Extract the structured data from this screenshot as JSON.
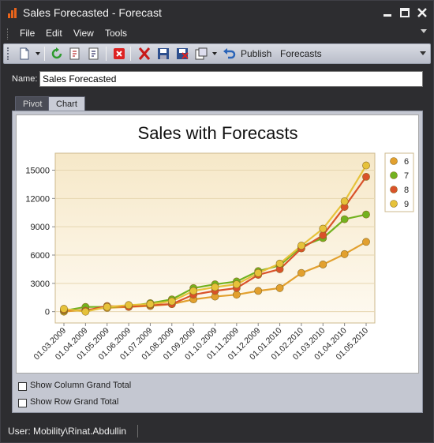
{
  "window": {
    "title": "Sales Forecasted - Forecast"
  },
  "menu": {
    "items": [
      "File",
      "Edit",
      "View",
      "Tools"
    ]
  },
  "toolbar": {
    "publish_label": "Publish",
    "forecasts_label": "Forecasts"
  },
  "form": {
    "name_label": "Name:",
    "name_value": "Sales Forecasted"
  },
  "tabs": {
    "pivot": "Pivot",
    "chart": "Chart",
    "active": "Chart"
  },
  "options": {
    "column_total": "Show Column Grand Total",
    "row_total": "Show Row Grand Total",
    "column_total_checked": false,
    "row_total_checked": false
  },
  "status": {
    "user": "User: Mobility\\Rinat.Abdullin"
  },
  "chart_data": {
    "type": "line",
    "title": "Sales with Forecasts",
    "xlabel": "",
    "ylabel": "",
    "ylim": [
      -1200,
      16800
    ],
    "yticks": [
      "0",
      "3000",
      "6000",
      "9000",
      "12000",
      "15000"
    ],
    "ytick_values": [
      0,
      3000,
      6000,
      9000,
      12000,
      15000
    ],
    "grid": true,
    "legend": "right",
    "categories": [
      "01.03.2009",
      "01.04.2009",
      "01.05.2009",
      "01.06.2009",
      "01.07.2009",
      "01.08.2009",
      "01.09.2009",
      "01.10.2009",
      "01.11.2009",
      "01.12.2009",
      "01.01.2010",
      "01.02.2010",
      "01.03.2010",
      "01.04.2010",
      "01.05.2010"
    ],
    "series": [
      {
        "name": "6",
        "color": "#e2a02e",
        "values": [
          0,
          200,
          400,
          500,
          600,
          800,
          1300,
          1600,
          1800,
          2200,
          2500,
          4100,
          5000,
          6100,
          7400
        ]
      },
      {
        "name": "7",
        "color": "#72b21f",
        "values": [
          100,
          500,
          500,
          600,
          900,
          1300,
          2500,
          2900,
          3200,
          4300,
          4900,
          6900,
          7800,
          9800,
          10300
        ]
      },
      {
        "name": "8",
        "color": "#d9522a",
        "values": [
          200,
          100,
          600,
          500,
          700,
          800,
          1800,
          2200,
          2500,
          3900,
          4500,
          6700,
          8100,
          11100,
          14300
        ]
      },
      {
        "name": "9",
        "color": "#e6c23a",
        "values": [
          300,
          0,
          500,
          700,
          800,
          1100,
          2200,
          2600,
          2900,
          4100,
          5100,
          7000,
          8800,
          11700,
          15500
        ]
      }
    ]
  }
}
